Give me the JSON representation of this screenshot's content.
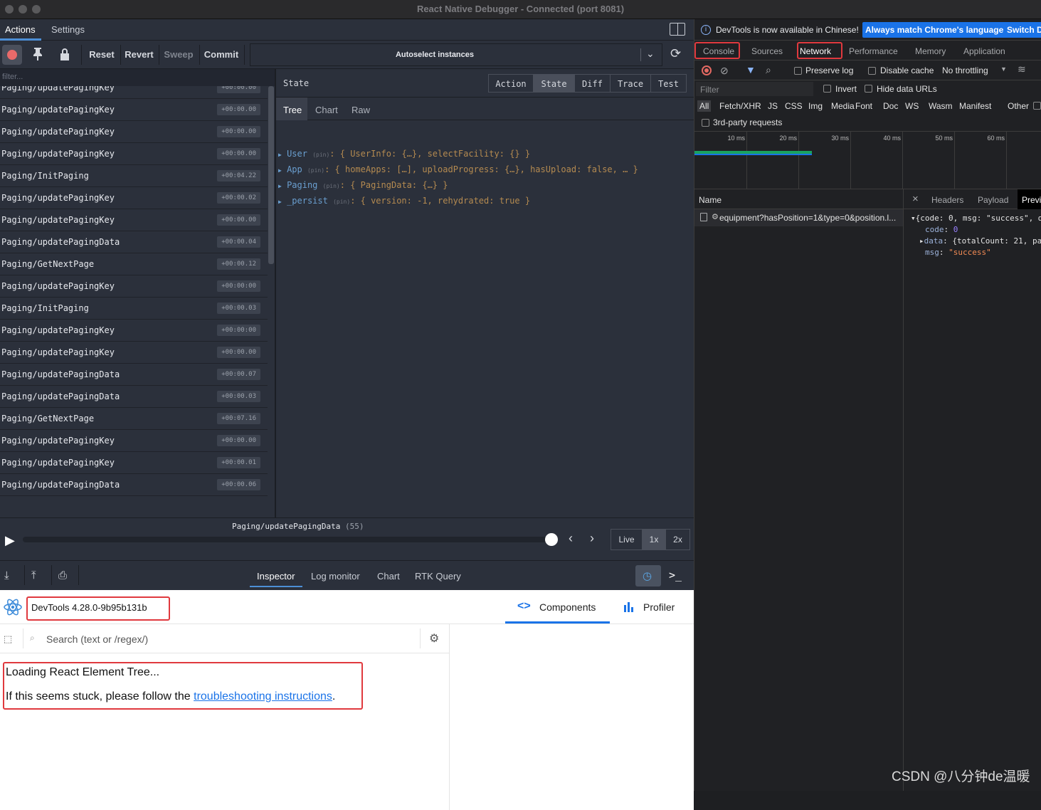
{
  "window": {
    "title": "React Native Debugger - Connected (port 8081)"
  },
  "left": {
    "tabs": [
      "Actions",
      "Settings"
    ],
    "toolbar": {
      "reset": "Reset",
      "revert": "Revert",
      "sweep": "Sweep",
      "commit": "Commit",
      "instances": "Autoselect instances"
    },
    "filter_placeholder": "filter...",
    "actions": [
      {
        "name": "Paging/updatePagingKey",
        "time": "+00:00.00"
      },
      {
        "name": "Paging/updatePagingKey",
        "time": "+00:00.00"
      },
      {
        "name": "Paging/updatePagingKey",
        "time": "+00:00.00"
      },
      {
        "name": "Paging/updatePagingKey",
        "time": "+00:00.00"
      },
      {
        "name": "Paging/InitPaging",
        "time": "+00:04.22"
      },
      {
        "name": "Paging/updatePagingKey",
        "time": "+00:00.02"
      },
      {
        "name": "Paging/updatePagingKey",
        "time": "+00:00.00"
      },
      {
        "name": "Paging/updatePagingData",
        "time": "+00:00.04"
      },
      {
        "name": "Paging/GetNextPage",
        "time": "+00:00.12"
      },
      {
        "name": "Paging/updatePagingKey",
        "time": "+00:00:00"
      },
      {
        "name": "Paging/InitPaging",
        "time": "+00:00.03"
      },
      {
        "name": "Paging/updatePagingKey",
        "time": "+00:00:00"
      },
      {
        "name": "Paging/updatePagingKey",
        "time": "+00:00.00"
      },
      {
        "name": "Paging/updatePagingData",
        "time": "+00:00.07"
      },
      {
        "name": "Paging/updatePagingData",
        "time": "+00:00.03"
      },
      {
        "name": "Paging/GetNextPage",
        "time": "+00:07.16"
      },
      {
        "name": "Paging/updatePagingKey",
        "time": "+00:00.00"
      },
      {
        "name": "Paging/updatePagingKey",
        "time": "+00:00.01"
      },
      {
        "name": "Paging/updatePagingData",
        "time": "+00:00.06"
      }
    ],
    "state_panel": {
      "label": "State",
      "buttons": [
        "Action",
        "State",
        "Diff",
        "Trace",
        "Test"
      ],
      "subtabs": [
        "Tree",
        "Chart",
        "Raw"
      ],
      "tree": [
        {
          "key": "User",
          "pin": "(pin)",
          "value": ": { UserInfo: {…}, selectFacility: {} }"
        },
        {
          "key": "App",
          "pin": "(pin)",
          "value": ": { homeApps: […], uploadProgress: {…}, hasUpload: false, … }"
        },
        {
          "key": "Paging",
          "pin": "(pin)",
          "value": ": { PagingData: {…} }"
        },
        {
          "key": "_persist",
          "pin": "(pin)",
          "value": ": { version: -1, rehydrated: true }"
        }
      ]
    },
    "slider": {
      "current": "Paging/updatePagingData",
      "count": "(55)",
      "live": "Live",
      "speed1": "1x",
      "speed2": "2x"
    },
    "bottom_tabs": [
      "Inspector",
      "Log monitor",
      "Chart",
      "RTK Query"
    ],
    "react_devtools": {
      "version": "DevTools 4.28.0-9b95b131b",
      "components": "Components",
      "profiler": "Profiler",
      "search_placeholder": "Search (text or /regex/)",
      "loading": "Loading React Element Tree...",
      "stuck_prefix": "If this seems stuck, please follow the",
      "stuck_link": "troubleshooting instructions",
      "stuck_suffix": "."
    }
  },
  "right": {
    "banner": "DevTools is now available in Chinese!",
    "banner_btn1": "Always match Chrome's language",
    "banner_btn2": "Switch D",
    "tabs": [
      "Console",
      "Sources",
      "Network",
      "Performance",
      "Memory",
      "Application"
    ],
    "preserve_log": "Preserve log",
    "disable_cache": "Disable cache",
    "throttling": "No throttling",
    "filter_placeholder": "Filter",
    "invert": "Invert",
    "hide_data_urls": "Hide data URLs",
    "types": [
      "All",
      "Fetch/XHR",
      "JS",
      "CSS",
      "Img",
      "Media",
      "Font",
      "Doc",
      "WS",
      "Wasm",
      "Manifest",
      "Other"
    ],
    "third_party": "3rd-party requests",
    "ticks": [
      "10 ms",
      "20 ms",
      "30 ms",
      "40 ms",
      "50 ms",
      "60 ms",
      "7"
    ],
    "name_header": "Name",
    "request": "equipment?hasPosition=1&type=0&position.l...",
    "detail_tabs": [
      "Headers",
      "Payload",
      "Previ"
    ],
    "preview": {
      "line1": "{code: 0, msg: \"success\", d",
      "code_key": "code",
      "code_val": "0",
      "data_key": "data",
      "data_val": "{totalCount: 21, pa",
      "msg_key": "msg",
      "msg_val": "\"success\""
    }
  },
  "watermark": "CSDN @八分钟de温暖",
  "colors": {
    "accent_blue": "#1a73e8",
    "highlight_red": "#e0393e",
    "timeline_green": "#1aa260"
  }
}
